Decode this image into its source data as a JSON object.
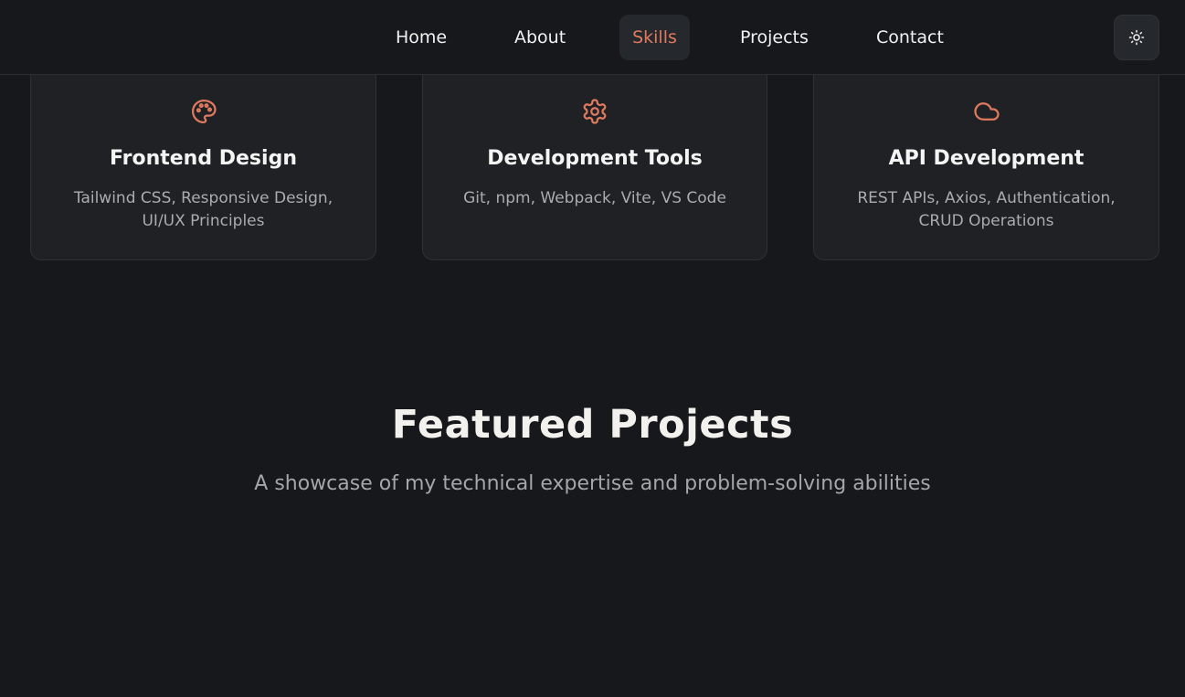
{
  "nav": {
    "items": [
      {
        "label": "Home"
      },
      {
        "label": "About"
      },
      {
        "label": "Skills"
      },
      {
        "label": "Projects"
      },
      {
        "label": "Contact"
      }
    ],
    "active": "Skills",
    "theme_toggle_icon": "sun-icon"
  },
  "skills": {
    "cards": [
      {
        "icon": "palette-icon",
        "title": "Frontend Design",
        "description": "Tailwind CSS, Responsive Design, UI/UX Principles"
      },
      {
        "icon": "gear-icon",
        "title": "Development Tools",
        "description": "Git, npm, Webpack, Vite, VS Code"
      },
      {
        "icon": "cloud-icon",
        "title": "API Development",
        "description": "REST APIs, Axios, Authentication, CRUD Operations"
      }
    ]
  },
  "projects": {
    "title": "Featured Projects",
    "subtitle": "A showcase of my technical expertise and problem-solving abilities"
  },
  "colors": {
    "background": "#16181b",
    "card": "#1f2124",
    "accent": "#e07a5f",
    "text": "#f1f1f1",
    "muted": "#a9acb0"
  }
}
